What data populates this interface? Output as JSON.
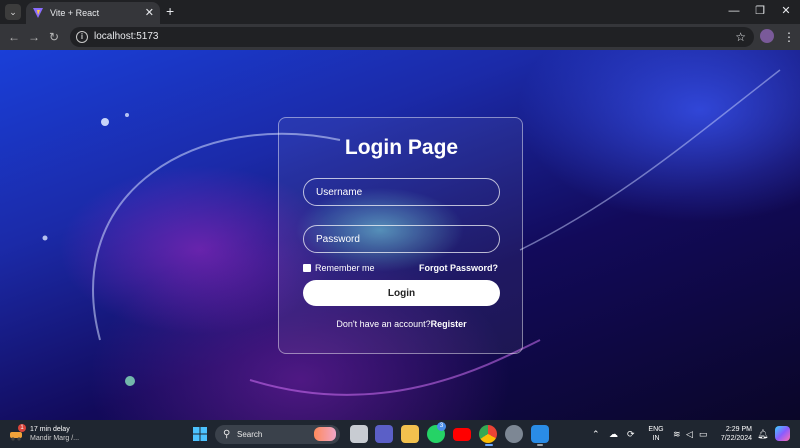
{
  "browser": {
    "tab": {
      "title": "Vite + React"
    },
    "address": {
      "url": "localhost:5173"
    }
  },
  "login": {
    "title": "Login Page",
    "username_placeholder": "Username",
    "password_placeholder": "Password",
    "remember_label": "Remember me",
    "forgot_label": "Forgot Password?",
    "login_label": "Login",
    "register_prompt": "Don't have an account?",
    "register_label": "Register"
  },
  "taskbar": {
    "weather": {
      "badge": "1",
      "title": "17 min delay",
      "subtitle": "Mandir Marg /..."
    },
    "search_label": "Search",
    "whatsapp_badge": "3",
    "lang": {
      "line1": "ENG",
      "line2": "IN"
    },
    "clock": {
      "time": "2:29 PM",
      "date": "7/22/2024"
    }
  },
  "icons": {
    "tab": [
      "tab-list-icon",
      "vite-favicon-icon",
      "close-icon",
      "plus-icon"
    ],
    "window": [
      "minimize-icon",
      "restore-icon",
      "close-icon"
    ],
    "nav": [
      "back-arrow-icon",
      "forward-arrow-icon",
      "reload-icon",
      "info-icon",
      "star-icon",
      "profile-avatar-icon",
      "kebab-menu-icon"
    ],
    "taskbar": [
      "weather-icon",
      "windows-start-icon",
      "search-icon",
      "file-explorer-icon",
      "teams-icon",
      "folder-icon",
      "whatsapp-icon",
      "youtube-icon",
      "chrome-icon",
      "settings-icon",
      "vscode-icon",
      "chevron-up-icon",
      "cloud-icon",
      "sync-icon",
      "wifi-icon",
      "volume-icon",
      "battery-icon",
      "bell-icon",
      "copilot-icon"
    ]
  }
}
